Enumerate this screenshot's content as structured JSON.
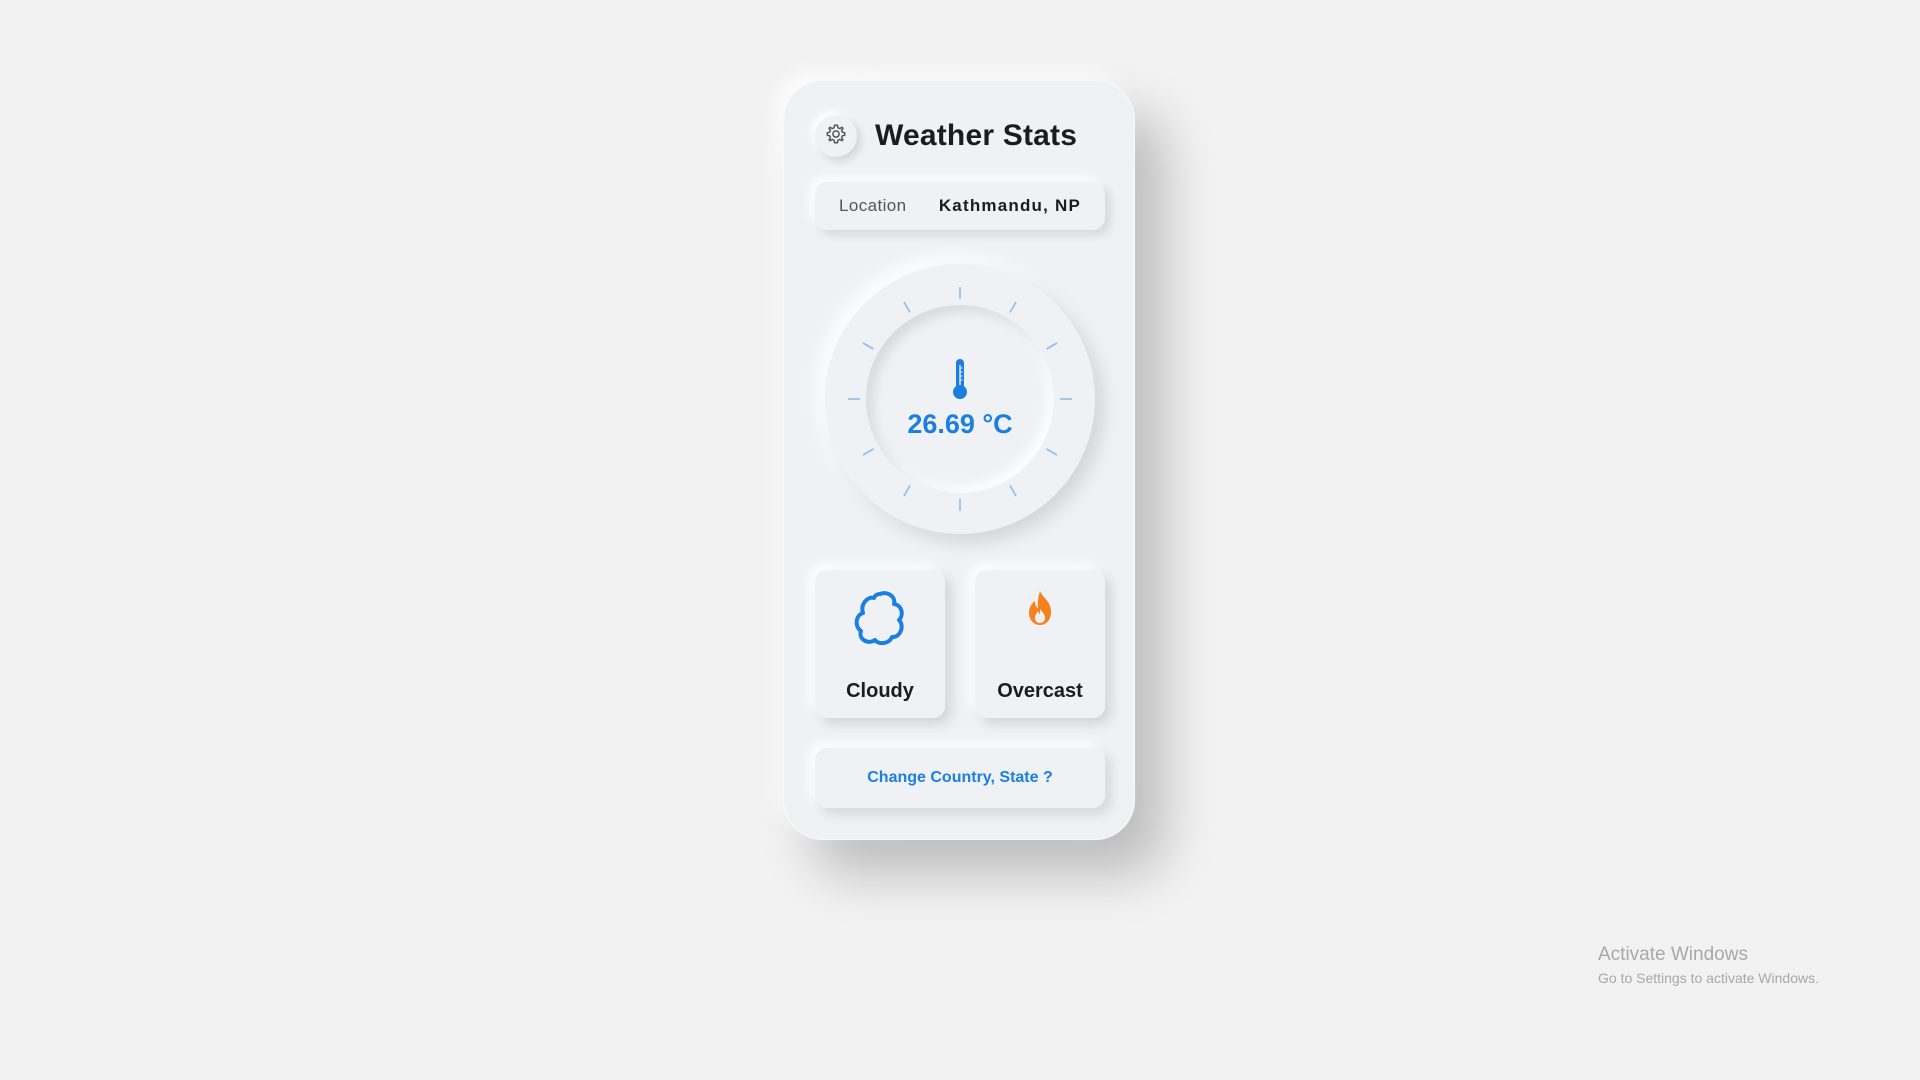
{
  "app": {
    "title": "Weather Stats"
  },
  "header": {
    "settings_icon": "gear-icon"
  },
  "location": {
    "label": "Location",
    "value": "Kathmandu, NP"
  },
  "temperature": {
    "value": "26.69 °C",
    "icon": "thermometer-icon"
  },
  "conditions": [
    {
      "label": "Cloudy",
      "icon": "cloud-icon",
      "color": "#1a7fe0"
    },
    {
      "label": "Overcast",
      "icon": "flame-icon",
      "color": "#f5821f"
    }
  ],
  "actions": {
    "change_location": "Change Country, State ?"
  },
  "os_watermark": {
    "title": "Activate Windows",
    "subtitle": "Go to Settings to activate Windows."
  },
  "colors": {
    "accent": "#1a7fe0",
    "background": "#f2f2f2",
    "card": "#eff1f4",
    "flame": "#f5821f"
  }
}
